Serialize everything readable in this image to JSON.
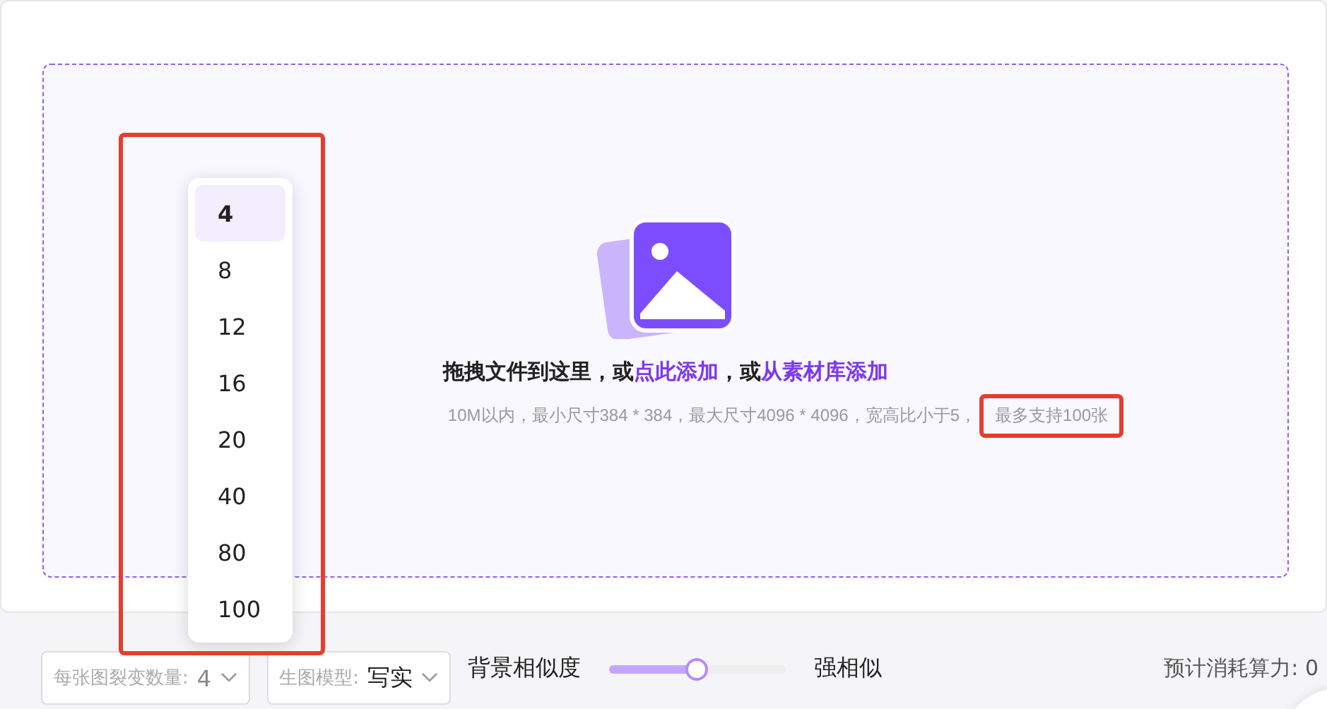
{
  "upload": {
    "title_parts": [
      {
        "kind": "plain",
        "text": "拖拽文件到这里，或"
      },
      {
        "kind": "link",
        "text": "点此添加"
      },
      {
        "kind": "plain",
        "text": "，或"
      },
      {
        "kind": "link",
        "text": "从素材库添加"
      }
    ],
    "hint": "10M以内，最小尺寸384 * 384，最大尺寸4096 * 4096，宽高比小于5，",
    "limit": "最多支持100张"
  },
  "dropdown": {
    "options": [
      {
        "label": "4",
        "selected": true
      },
      {
        "label": "8",
        "selected": false
      },
      {
        "label": "12",
        "selected": false
      },
      {
        "label": "16",
        "selected": false
      },
      {
        "label": "20",
        "selected": false
      },
      {
        "label": "40",
        "selected": false
      },
      {
        "label": "80",
        "selected": false
      },
      {
        "label": "100",
        "selected": false
      }
    ]
  },
  "controls": {
    "variant_count": {
      "label": "每张图裂变数量:",
      "value": "4"
    },
    "model": {
      "label": "生图模型:",
      "value": "写实"
    },
    "similarity": {
      "label": "背景相似度",
      "level": 0.5,
      "end_label": "强相似"
    },
    "cost": "预计消耗算力: 0"
  }
}
